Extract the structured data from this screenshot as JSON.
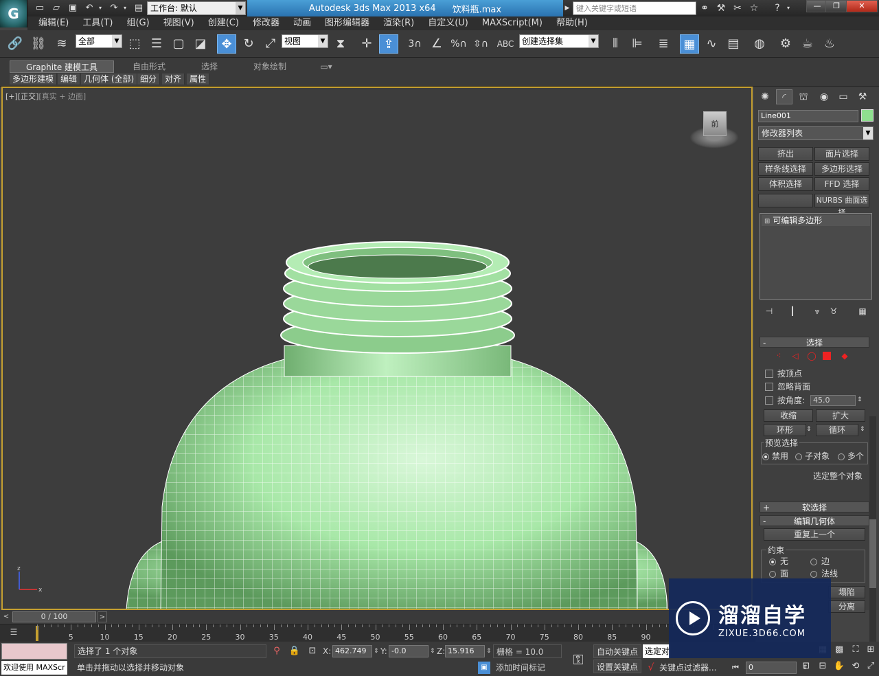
{
  "titlebar": {
    "workspace": "工作台: 默认",
    "app_title": "Autodesk 3ds Max  2013 x64",
    "file_name": "饮料瓶.max",
    "search_placeholder": "键入关键字或短语"
  },
  "menu": [
    "编辑(E)",
    "工具(T)",
    "组(G)",
    "视图(V)",
    "创建(C)",
    "修改器",
    "动画",
    "图形编辑器",
    "渲染(R)",
    "自定义(U)",
    "MAXScript(M)",
    "帮助(H)"
  ],
  "toolbar": {
    "selection_filter": "全部",
    "ref_coord": "视图",
    "named_selection": "创建选择集",
    "snap_3": "3"
  },
  "ribbon": {
    "tabs": [
      "Graphite 建模工具",
      "自由形式",
      "选择",
      "对象绘制"
    ],
    "sub_tabs": [
      "多边形建模",
      "编辑",
      "几何体 (全部)",
      "细分",
      "对齐",
      "属性"
    ]
  },
  "viewport": {
    "label_plus": "[+]",
    "label_view": "[正交]",
    "label_shading": "[真实 + 边面]",
    "viewcube_face": "前",
    "mesh_color": "#a8e8a8"
  },
  "command_panel": {
    "object_name": "Line001",
    "object_color": "#8fe08f",
    "modifier_list": "修改器列表",
    "mod_buttons": [
      "挤出",
      "面片选择",
      "样条线选择",
      "多边形选择",
      "体积选择",
      "FFD 选择",
      "",
      "NURBS 曲面选择"
    ],
    "stack_item": "可编辑多边形",
    "selection_rollout": "选择",
    "by_vertex": "按顶点",
    "ignore_backfacing": "忽略背面",
    "by_angle": "按角度:",
    "angle_value": "45.0",
    "shrink": "收缩",
    "grow": "扩大",
    "ring": "环形",
    "loop": "循环",
    "preview_group": "预览选择",
    "preview_options": [
      "禁用",
      "子对象",
      "多个"
    ],
    "select_whole": "选定整个对象",
    "soft_selection": "软选择",
    "edit_geometry": "编辑几何体",
    "repeat_last": "重复上一个",
    "constraints": "约束",
    "constraint_options": [
      "无",
      "边",
      "面",
      "法线"
    ],
    "collapse": "塌陷",
    "detach": "分离"
  },
  "timeline": {
    "frame_display": "0 / 100",
    "ticks": [
      "5",
      "10",
      "15",
      "20",
      "25",
      "30",
      "35",
      "40",
      "45",
      "50",
      "55",
      "60",
      "65",
      "70",
      "75",
      "80",
      "85",
      "90"
    ]
  },
  "status": {
    "maxscript": "欢迎使用 MAXScr",
    "selected": "选择了 1 个对象",
    "prompt": "单击并拖动以选择并移动对象",
    "x_label": "X:",
    "x_value": "462.749",
    "y_label": "Y:",
    "y_value": "-0.0",
    "z_label": "Z:",
    "z_value": "15.916",
    "grid": "栅格 = 10.0",
    "add_time_tag": "添加时间标记",
    "auto_key": "自动关键点",
    "set_key": "设置关键点",
    "selected_set": "选定对象",
    "key_filters": "关键点过滤器...",
    "frame": "0"
  },
  "watermark": {
    "title": "溜溜自学",
    "subtitle": "ZIXUE.3D66.COM"
  }
}
